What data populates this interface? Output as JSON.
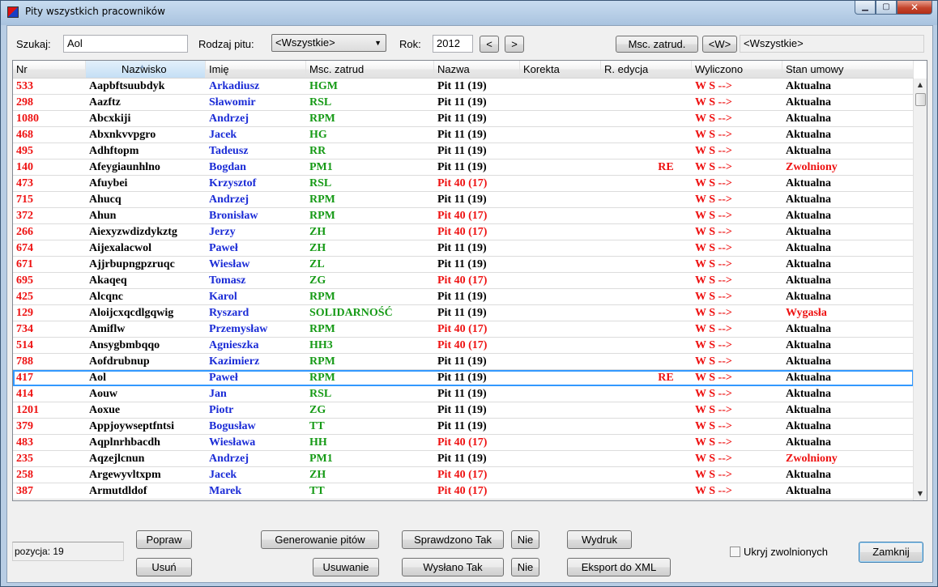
{
  "window": {
    "title": "Pity wszystkich pracowników"
  },
  "toolbar": {
    "search_label": "Szukaj:",
    "search_value": "Aol",
    "type_label": "Rodzaj pitu:",
    "type_value": "<Wszystkie>",
    "year_label": "Rok:",
    "year_value": "2012",
    "prev": "<",
    "next": ">",
    "msc_button": "Msc. zatrud.",
    "w_button": "<W>",
    "msc_value": "<Wszystkie>"
  },
  "columns": [
    "Nr",
    "Nazwisko",
    "Imię",
    "Msc. zatrud",
    "Nazwa",
    "Korekta",
    "R. edycja",
    "Wyliczono",
    "Stan umowy"
  ],
  "colors": {
    "red": "#ee1111",
    "blue": "#1a2bd6",
    "green": "#169a16",
    "black": "#000000"
  },
  "rows": [
    {
      "nr": "533",
      "nazwisko": "Aapbftsuubdyk",
      "imie": "Arkadiusz",
      "msc": "HGM",
      "nazwa": "Pit 11 (19)",
      "korekta": "",
      "redycja": "",
      "wyl": "W S -->",
      "stan": "Aktualna"
    },
    {
      "nr": "298",
      "nazwisko": "Aazftz",
      "imie": "Sławomir",
      "msc": "RSL",
      "nazwa": "Pit 11 (19)",
      "korekta": "",
      "redycja": "",
      "wyl": "W S -->",
      "stan": "Aktualna"
    },
    {
      "nr": "1080",
      "nazwisko": "Abcxkiji",
      "imie": "Andrzej",
      "msc": "RPM",
      "nazwa": "Pit 11 (19)",
      "korekta": "",
      "redycja": "",
      "wyl": "W S -->",
      "stan": "Aktualna"
    },
    {
      "nr": "468",
      "nazwisko": "Abxnkvvpgro",
      "imie": "Jacek",
      "msc": "HG",
      "nazwa": "Pit 11 (19)",
      "korekta": "",
      "redycja": "",
      "wyl": "W S -->",
      "stan": "Aktualna"
    },
    {
      "nr": "495",
      "nazwisko": "Adhftopm",
      "imie": "Tadeusz",
      "msc": "RR",
      "nazwa": "Pit 11 (19)",
      "korekta": "",
      "redycja": "",
      "wyl": "W S -->",
      "stan": "Aktualna"
    },
    {
      "nr": "140",
      "nazwisko": "Afeygiaunhlno",
      "imie": "Bogdan",
      "msc": "PM1",
      "nazwa": "Pit 11 (19)",
      "korekta": "",
      "redycja": "RE",
      "wyl": "W S -->",
      "stan": "Zwolniony"
    },
    {
      "nr": "473",
      "nazwisko": "Afuybei",
      "imie": "Krzysztof",
      "msc": "RSL",
      "nazwa": "Pit 40 (17)",
      "korekta": "",
      "redycja": "",
      "wyl": "W S -->",
      "stan": "Aktualna"
    },
    {
      "nr": "715",
      "nazwisko": "Ahucq",
      "imie": "Andrzej",
      "msc": "RPM",
      "nazwa": "Pit 11 (19)",
      "korekta": "",
      "redycja": "",
      "wyl": "W S -->",
      "stan": "Aktualna"
    },
    {
      "nr": "372",
      "nazwisko": "Ahun",
      "imie": "Bronisław",
      "msc": "RPM",
      "nazwa": "Pit 40 (17)",
      "korekta": "",
      "redycja": "",
      "wyl": "W S -->",
      "stan": "Aktualna"
    },
    {
      "nr": "266",
      "nazwisko": "Aiexyzwdizdykztg",
      "imie": "Jerzy",
      "msc": "ZH",
      "nazwa": "Pit 40 (17)",
      "korekta": "",
      "redycja": "",
      "wyl": "W S -->",
      "stan": "Aktualna"
    },
    {
      "nr": "674",
      "nazwisko": "Aijexalacwol",
      "imie": "Paweł",
      "msc": "ZH",
      "nazwa": "Pit 11 (19)",
      "korekta": "",
      "redycja": "",
      "wyl": "W S -->",
      "stan": "Aktualna"
    },
    {
      "nr": "671",
      "nazwisko": "Ajjrbupngpzruqc",
      "imie": "Wiesław",
      "msc": "ZL",
      "nazwa": "Pit 11 (19)",
      "korekta": "",
      "redycja": "",
      "wyl": "W S -->",
      "stan": "Aktualna"
    },
    {
      "nr": "695",
      "nazwisko": "Akaqeq",
      "imie": "Tomasz",
      "msc": "ZG",
      "nazwa": "Pit 40 (17)",
      "korekta": "",
      "redycja": "",
      "wyl": "W S -->",
      "stan": "Aktualna"
    },
    {
      "nr": "425",
      "nazwisko": "Alcqnc",
      "imie": "Karol",
      "msc": "RPM",
      "nazwa": "Pit 11 (19)",
      "korekta": "",
      "redycja": "",
      "wyl": "W S -->",
      "stan": "Aktualna"
    },
    {
      "nr": "129",
      "nazwisko": "Aloijcxqcdlgqwig",
      "imie": "Ryszard",
      "msc": "SOLIDARNOŚĆ",
      "nazwa": "Pit 11 (19)",
      "korekta": "",
      "redycja": "",
      "wyl": "W S -->",
      "stan": "Wygasła"
    },
    {
      "nr": "734",
      "nazwisko": "Amiflw",
      "imie": "Przemysław",
      "msc": "RPM",
      "nazwa": "Pit 40 (17)",
      "korekta": "",
      "redycja": "",
      "wyl": "W S -->",
      "stan": "Aktualna"
    },
    {
      "nr": "514",
      "nazwisko": "Ansygbmbqqo",
      "imie": "Agnieszka",
      "msc": "HH3",
      "nazwa": "Pit 40 (17)",
      "korekta": "",
      "redycja": "",
      "wyl": "W S -->",
      "stan": "Aktualna"
    },
    {
      "nr": "788",
      "nazwisko": "Aofdrubnup",
      "imie": "Kazimierz",
      "msc": "RPM",
      "nazwa": "Pit 11 (19)",
      "korekta": "",
      "redycja": "",
      "wyl": "W S -->",
      "stan": "Aktualna"
    },
    {
      "nr": "417",
      "nazwisko": "Aol",
      "imie": "Paweł",
      "msc": "RPM",
      "nazwa": "Pit 11 (19)",
      "korekta": "",
      "redycja": "RE",
      "wyl": "W S -->",
      "stan": "Aktualna",
      "selected": true
    },
    {
      "nr": "414",
      "nazwisko": "Aouw",
      "imie": "Jan",
      "msc": "RSL",
      "nazwa": "Pit 11 (19)",
      "korekta": "",
      "redycja": "",
      "wyl": "W S -->",
      "stan": "Aktualna"
    },
    {
      "nr": "1201",
      "nazwisko": "Aoxue",
      "imie": "Piotr",
      "msc": "ZG",
      "nazwa": "Pit 11 (19)",
      "korekta": "",
      "redycja": "",
      "wyl": "W S -->",
      "stan": "Aktualna"
    },
    {
      "nr": "379",
      "nazwisko": "Appjoywseptfntsi",
      "imie": "Bogusław",
      "msc": "TT",
      "nazwa": "Pit 11 (19)",
      "korekta": "",
      "redycja": "",
      "wyl": "W S -->",
      "stan": "Aktualna"
    },
    {
      "nr": "483",
      "nazwisko": "Aqplnrhbacdh",
      "imie": "Wiesława",
      "msc": "HH",
      "nazwa": "Pit 40 (17)",
      "korekta": "",
      "redycja": "",
      "wyl": "W S -->",
      "stan": "Aktualna"
    },
    {
      "nr": "235",
      "nazwisko": "Aqzejlcnun",
      "imie": "Andrzej",
      "msc": "PM1",
      "nazwa": "Pit 11 (19)",
      "korekta": "",
      "redycja": "",
      "wyl": "W S -->",
      "stan": "Zwolniony"
    },
    {
      "nr": "258",
      "nazwisko": "Argewyvltxpm",
      "imie": "Jacek",
      "msc": "ZH",
      "nazwa": "Pit 40 (17)",
      "korekta": "",
      "redycja": "",
      "wyl": "W S -->",
      "stan": "Aktualna"
    },
    {
      "nr": "387",
      "nazwisko": "Armutdldof",
      "imie": "Marek",
      "msc": "TT",
      "nazwa": "Pit 40 (17)",
      "korekta": "",
      "redycja": "",
      "wyl": "W S -->",
      "stan": "Aktualna"
    }
  ],
  "footer": {
    "position_text": "pozycja:  19",
    "popraw": "Popraw",
    "usun": "Usuń",
    "generowanie": "Generowanie pitów",
    "usuwanie": "Usuwanie",
    "sprawdzono_tak": "Sprawdzono Tak",
    "sprawdzono_nie": "Nie",
    "wyslano_tak": "Wysłano Tak",
    "wyslano_nie": "Nie",
    "wydruk": "Wydruk",
    "eksport": "Eksport do XML",
    "ukryj": "Ukryj zwolnionych",
    "zamknij": "Zamknij"
  }
}
